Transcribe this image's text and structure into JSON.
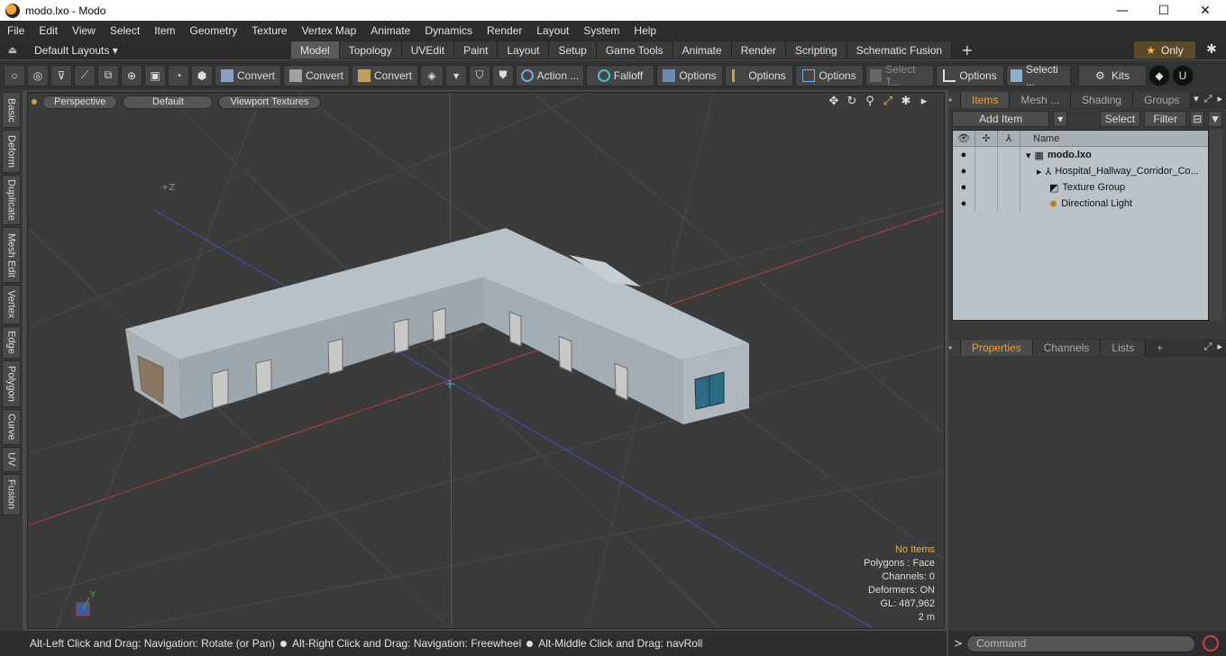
{
  "window": {
    "title": "modo.lxo - Modo",
    "minimize": "—",
    "maximize": "☐",
    "close": "✕"
  },
  "menu": [
    "File",
    "Edit",
    "View",
    "Select",
    "Item",
    "Geometry",
    "Texture",
    "Vertex Map",
    "Animate",
    "Dynamics",
    "Render",
    "Layout",
    "System",
    "Help"
  ],
  "layouts": {
    "label": "Default Layouts ▾",
    "tabs": [
      "Model",
      "Topology",
      "UVEdit",
      "Paint",
      "Layout",
      "Setup",
      "Game Tools",
      "Animate",
      "Render",
      "Scripting",
      "Schematic Fusion"
    ],
    "active_tab": "Model",
    "add": "+",
    "only": "Only"
  },
  "toolbar": {
    "convert1": "Convert",
    "convert2": "Convert",
    "convert3": "Convert",
    "action": "Action",
    "action_more": "...",
    "falloff": "Falloff",
    "options1": "Options",
    "options2": "Options",
    "options3": "Options",
    "select_t": "Select T...",
    "options4": "Options",
    "selecti": "Selecti ...",
    "kits": "Kits"
  },
  "left_tabs": [
    "Basic",
    "Deform",
    "Duplicate",
    "Mesh Edit",
    "Vertex",
    "Edge",
    "Polygon",
    "Curve",
    "UV",
    "Fusion"
  ],
  "viewport": {
    "perspective": "Perspective",
    "shading": "Default",
    "textures": "Viewport Textures",
    "axis_z": "+Z",
    "axis_y": "Y",
    "info": {
      "no_items": "No Items",
      "polygons": "Polygons : Face",
      "channels": "Channels: 0",
      "deformers": "Deformers: ON",
      "gl": "GL: 487,962",
      "scale": "2 m"
    }
  },
  "status": {
    "hint1": "Alt-Left Click and Drag: Navigation: Rotate (or Pan)",
    "hint2": "Alt-Right Click and Drag: Navigation: Freewheel",
    "hint3": "Alt-Middle Click and Drag: navRoll"
  },
  "items_panel": {
    "tabs": [
      "Items",
      "Mesh ...",
      "Shading",
      "Groups"
    ],
    "active": "Items",
    "add_item": "Add Item",
    "add_item_dd": "▾",
    "select": "Select",
    "filter": "Filter",
    "col_name": "Name",
    "rows": [
      {
        "name": "modo.lxo",
        "bold": true
      },
      {
        "name": "Hospital_Hallway_Corridor_Co..."
      },
      {
        "name": "Texture Group"
      },
      {
        "name": "Directional Light"
      }
    ]
  },
  "props_panel": {
    "tabs": [
      "Properties",
      "Channels",
      "Lists"
    ],
    "active": "Properties",
    "add": "+"
  },
  "command": {
    "placeholder": "Command",
    "prompt": ">"
  }
}
